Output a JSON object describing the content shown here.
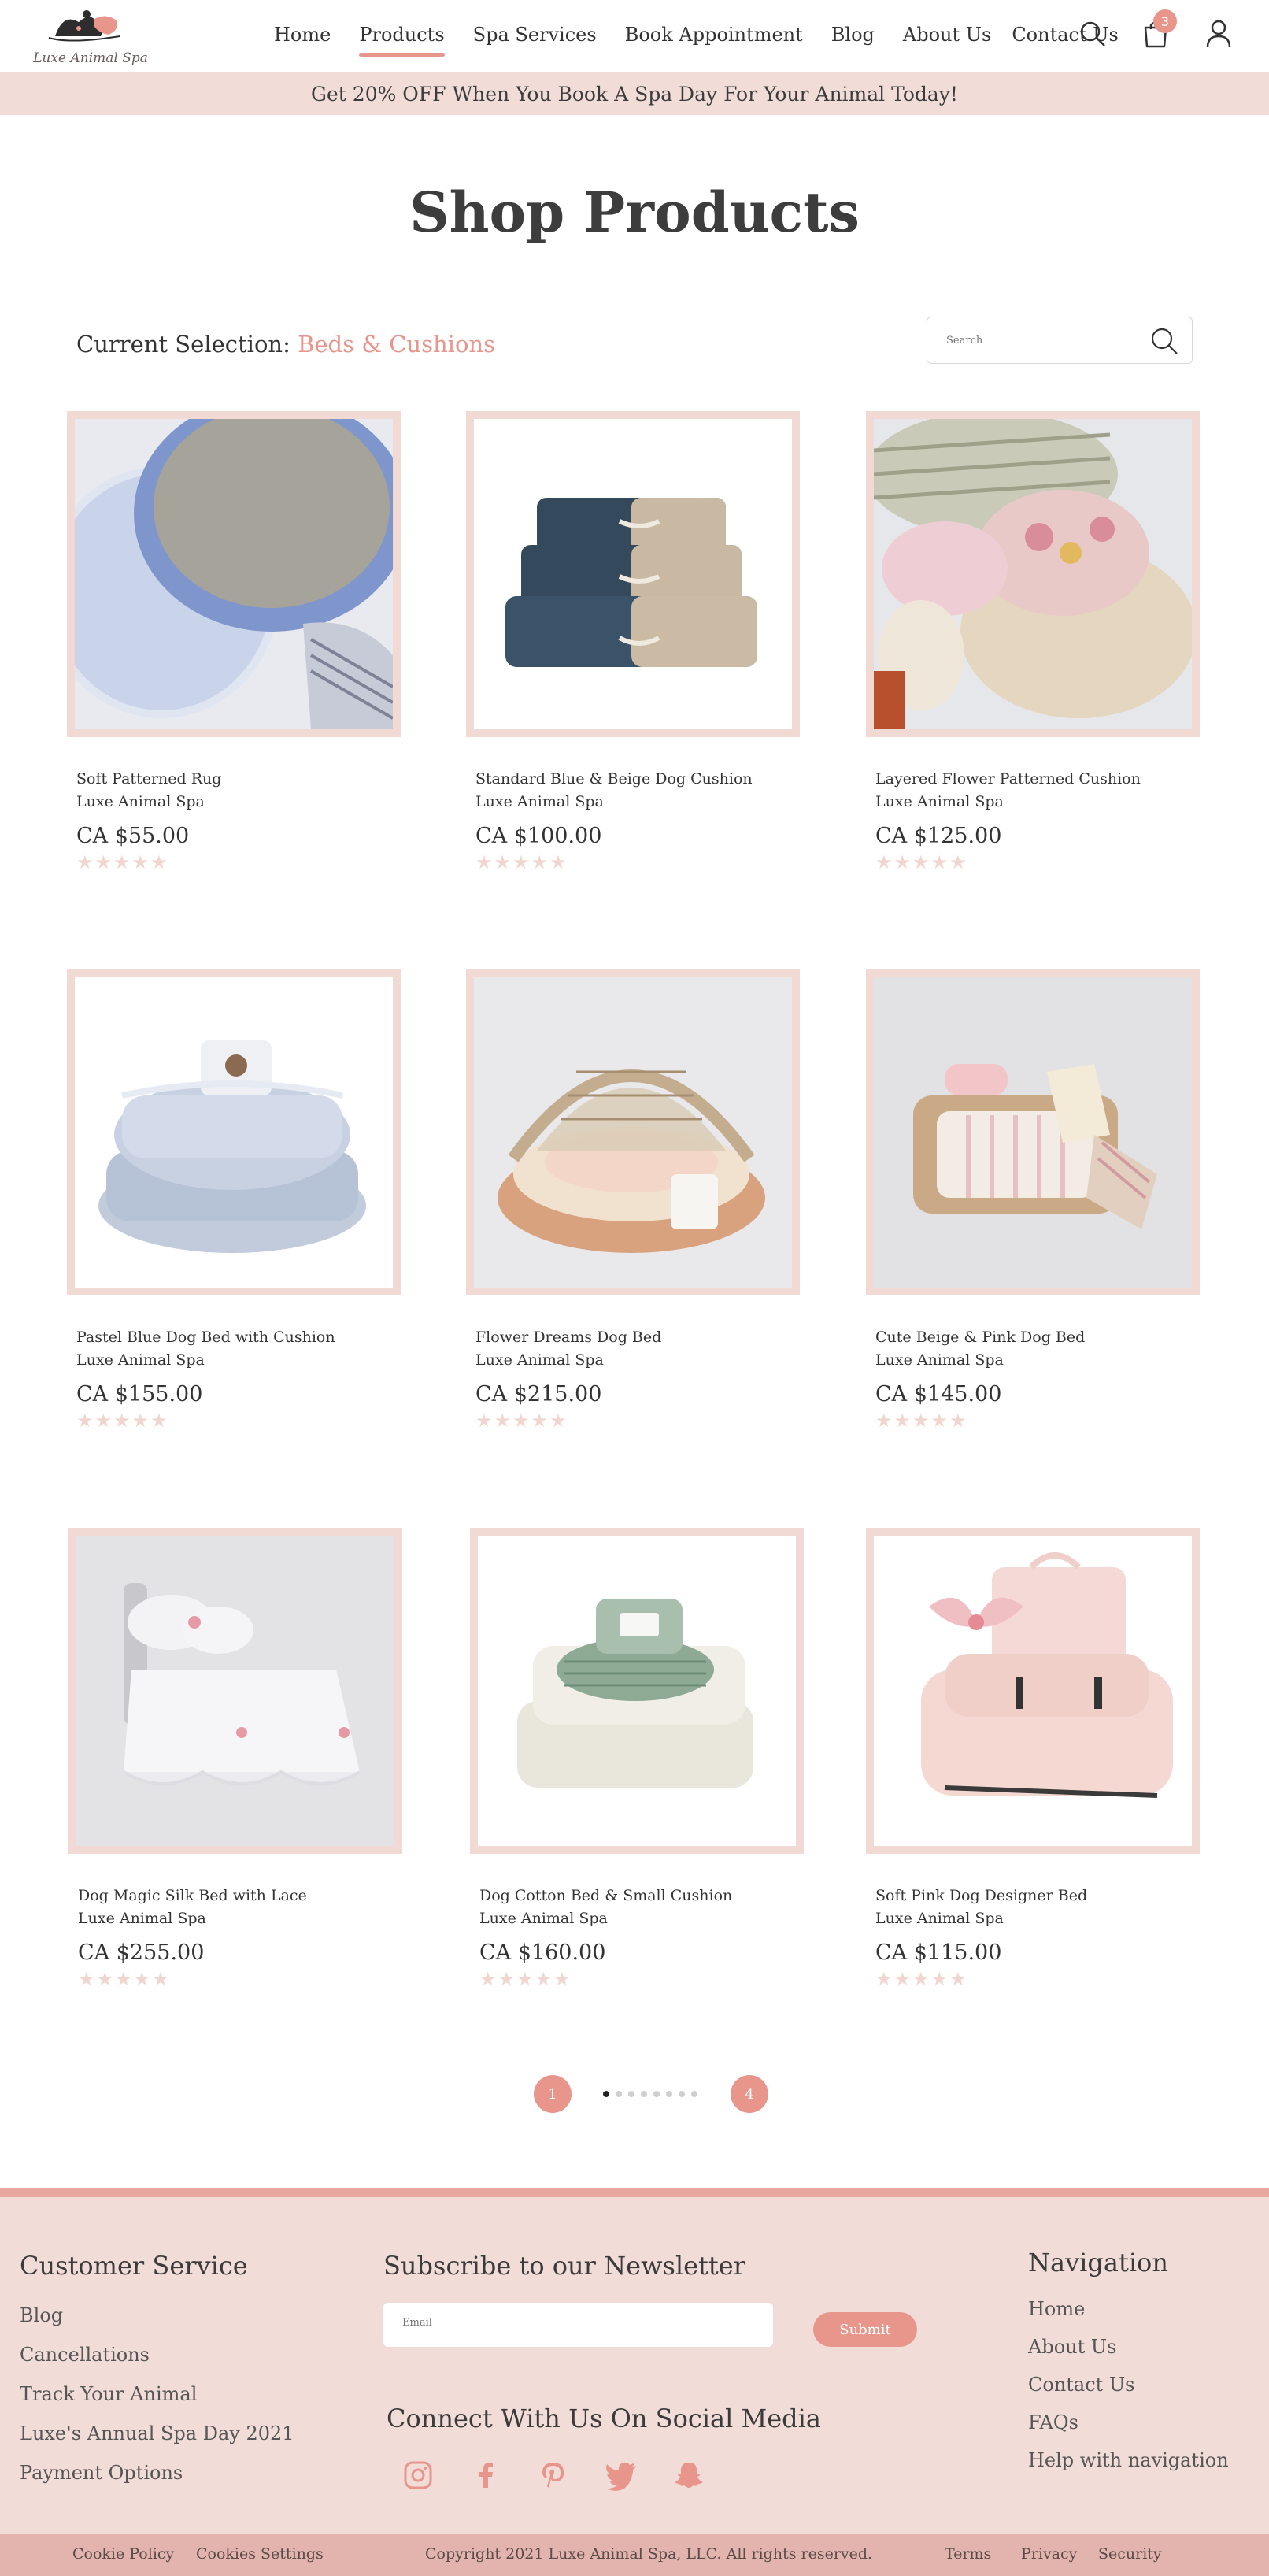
{
  "header": {
    "logo_text": "Luxe Animal Spa",
    "nav": [
      "Home",
      "Products",
      "Spa Services",
      "Book Appointment",
      "Blog",
      "About Us",
      "Contact Us"
    ],
    "active_nav": "Products",
    "cart_count": "3"
  },
  "promo": "Get 20% OFF When You Book A Spa Day For Your Animal Today!",
  "page_title": "Shop Products",
  "selection": {
    "label": "Current Selection:",
    "category": "Beds & Cushions"
  },
  "search": {
    "placeholder": "Search"
  },
  "products": [
    {
      "name": "Soft Patterned Rug",
      "brand": "Luxe Animal Spa",
      "price": "CA $55.00",
      "rating": 0
    },
    {
      "name": "Standard Blue & Beige Dog Cushion",
      "brand": "Luxe Animal Spa",
      "price": "CA $100.00",
      "rating": 0
    },
    {
      "name": "Layered Flower Patterned Cushion",
      "brand": "Luxe Animal Spa",
      "price": "CA $125.00",
      "rating": 0
    },
    {
      "name": "Pastel Blue Dog Bed with Cushion",
      "brand": "Luxe Animal Spa",
      "price": "CA $155.00",
      "rating": 0
    },
    {
      "name": "Flower Dreams Dog Bed",
      "brand": "Luxe Animal Spa",
      "price": "CA $215.00",
      "rating": 0
    },
    {
      "name": "Cute Beige & Pink Dog Bed",
      "brand": "Luxe Animal Spa",
      "price": "CA $145.00",
      "rating": 0
    },
    {
      "name": "Dog Magic Silk Bed with Lace",
      "brand": "Luxe Animal Spa",
      "price": "CA $255.00",
      "rating": 0
    },
    {
      "name": "Dog Cotton Bed & Small Cushion",
      "brand": "Luxe Animal Spa",
      "price": "CA $160.00",
      "rating": 0
    },
    {
      "name": "Soft Pink Dog Designer Bed",
      "brand": "Luxe Animal Spa",
      "price": "CA $115.00",
      "rating": 0
    }
  ],
  "stars": "★★★★★",
  "pagination": {
    "first": "1",
    "last": "4",
    "dot_count": 8,
    "active_dot": 0
  },
  "footer": {
    "customer_service": {
      "title": "Customer Service",
      "links": [
        "Blog",
        "Cancellations",
        "Track Your Animal",
        "Luxe's Annual Spa Day 2021",
        "Payment Options"
      ]
    },
    "newsletter": {
      "title": "Subscribe to our Newsletter",
      "email_placeholder": "Email",
      "submit_label": "Submit"
    },
    "social": {
      "title": "Connect With Us On Social Media",
      "icons": [
        "instagram-icon",
        "facebook-icon",
        "pinterest-icon",
        "twitter-icon",
        "snapchat-icon"
      ]
    },
    "navigation": {
      "title": "Navigation",
      "links": [
        "Home",
        "About Us",
        "Contact Us",
        "FAQs",
        "Help with navigation"
      ]
    }
  },
  "bottom_bar": {
    "cookie_policy": "Cookie Policy",
    "cookies_settings": "Cookies Settings",
    "copyright": "Copyright 2021 Luxe Animal Spa, LLC. All rights reserved.",
    "terms": "Terms",
    "privacy": "Privacy",
    "security": "Security"
  },
  "colors": {
    "accent": "#e8958c",
    "promo_bg": "#f1dcd8",
    "frame": "#f2dad4",
    "footer_bg": "#f1dcd8",
    "bottom_bar": "#e3b4ad"
  }
}
